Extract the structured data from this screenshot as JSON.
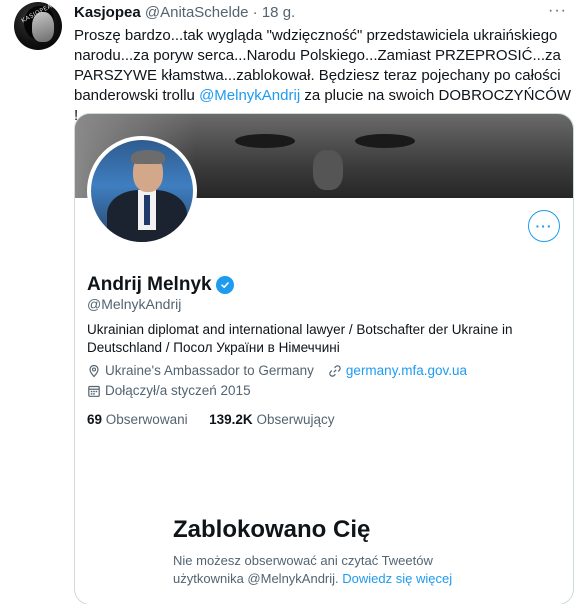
{
  "tweet": {
    "author_name": "Kasjopea",
    "author_handle": "@AnitaSchelde",
    "separator": "·",
    "time": "18 g.",
    "avatar_tag": "KASJOPEA",
    "text_part1": "Proszę bardzo...tak wygląda \"wdzięczność\" przedstawiciela ukraińskiego narodu...za poryw serca...Narodu Polskiego...Zamiast PRZEPROSIĆ...za PARSZYWE kłamstwa...zablokował. Będziesz teraz pojechany po całości banderowski trollu ",
    "mention": "@MelnykAndrij",
    "text_part2": " za plucie na swoich DOBROCZYŃCÓW !"
  },
  "profile_card": {
    "name": "Andrij Melnyk",
    "handle": "@MelnykAndrij",
    "bio": "Ukrainian diplomat and international lawyer / Botschafter der Ukraine in Deutschland / Посол України в Німеччині",
    "location": "Ukraine's Ambassador to Germany",
    "website": "germany.mfa.gov.ua",
    "joined": "Dołączył/a styczeń 2015",
    "following_count": "69",
    "following_label": "Obserwowani",
    "followers_count": "139.2K",
    "followers_label": "Obserwujący",
    "more_button": "···"
  },
  "blocked": {
    "title": "Zablokowano Cię",
    "text": "Nie możesz obserwować ani czytać Tweetów użytkownika @MelnykAndrij. ",
    "learn_more": "Dowiedz się więcej"
  },
  "colors": {
    "accent": "#1d9bf0",
    "text": "#0f1419",
    "muted": "#536471",
    "border": "#cfd9de"
  },
  "icons": [
    "location-pin-icon",
    "link-icon",
    "calendar-icon",
    "verified-badge-icon",
    "more-options-icon"
  ]
}
